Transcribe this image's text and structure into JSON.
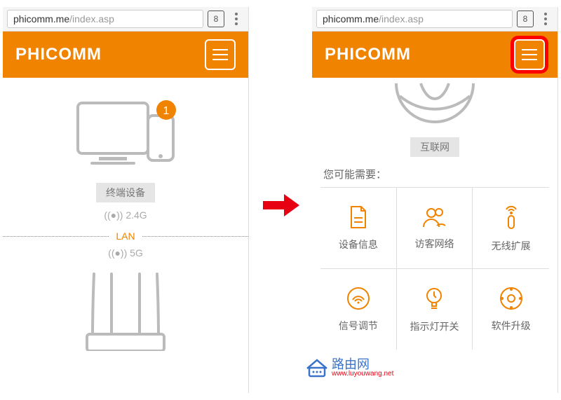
{
  "url": {
    "host": "phicomm.me",
    "path": "/index.asp"
  },
  "tab_count": "8",
  "brand": "PHICOMM",
  "screen1": {
    "terminal_label": "终端设备",
    "wifi_24": "2.4G",
    "lan_label": "LAN",
    "wifi_5": "5G",
    "device_badge": "1"
  },
  "screen2": {
    "internet_label": "互联网",
    "section_title": "您可能需要：",
    "grid": [
      {
        "icon": "document-icon",
        "label": "设备信息"
      },
      {
        "icon": "guests-icon",
        "label": "访客网络"
      },
      {
        "icon": "repeater-icon",
        "label": "无线扩展"
      },
      {
        "icon": "signal-icon",
        "label": "信号调节"
      },
      {
        "icon": "bulb-icon",
        "label": "指示灯开关"
      },
      {
        "icon": "upgrade-icon",
        "label": "软件升级"
      }
    ]
  },
  "watermark": {
    "title": "路由网",
    "url": "www.luyouwang.net"
  }
}
